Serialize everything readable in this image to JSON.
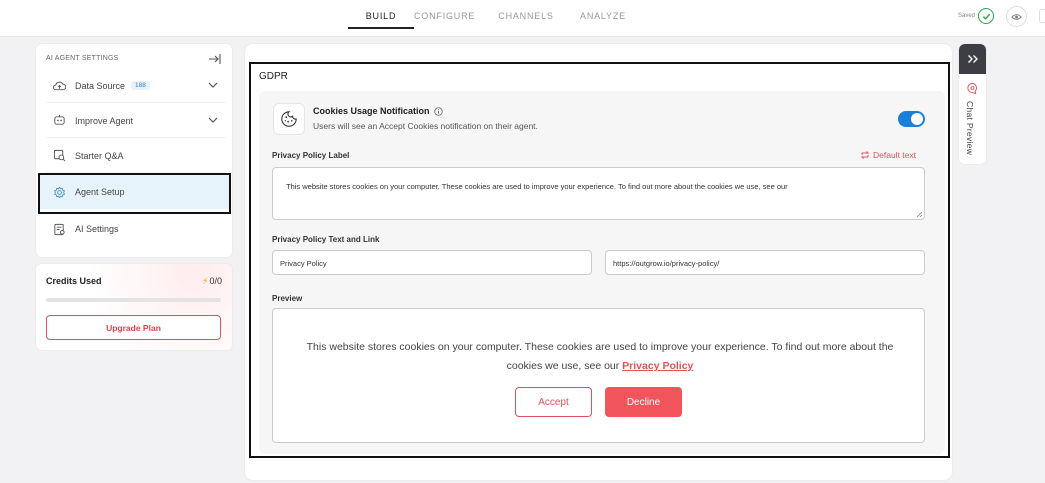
{
  "nav": {
    "tabs": [
      "BUILD",
      "CONFIGURE",
      "CHANNELS",
      "ANALYZE"
    ],
    "active_tab": "BUILD",
    "saved_label": "Saved"
  },
  "sidebar": {
    "header": "AI AGENT SETTINGS",
    "items": [
      {
        "label": "Data Source",
        "badge": "188",
        "icon": "data-source-icon"
      },
      {
        "label": "Improve Agent",
        "icon": "improve-agent-icon"
      },
      {
        "label": "Starter Q&A",
        "icon": "starter-qa-icon"
      },
      {
        "label": "Agent Setup",
        "icon": "gear-icon",
        "active": true
      },
      {
        "label": "AI Settings",
        "icon": "ai-settings-icon"
      }
    ]
  },
  "credits": {
    "title": "Credits Used",
    "value": "0/0",
    "progress": 0,
    "upgrade_label": "Upgrade Plan"
  },
  "gdpr": {
    "title": "GDPR",
    "cookie_title": "Cookies Usage Notification",
    "cookie_desc": "Users will see an Accept Cookies notification on their agent.",
    "toggle_on": true,
    "privacy_label_title": "Privacy Policy Label",
    "default_text": "Default text",
    "privacy_label_value": "This website stores cookies on your computer. These cookies are used to improve your experience. To find out more about the cookies we use, see our",
    "text_link_title": "Privacy Policy Text and Link",
    "policy_text": "Privacy Policy",
    "policy_link": "https://outgrow.io/privacy-policy/",
    "preview_title": "Preview",
    "preview_message": "This website stores cookies on your computer. These cookies are used to improve your experience. To find out more about the cookies we use, see our ",
    "preview_link": "Privacy Policy",
    "accept_label": "Accept",
    "decline_label": "Decline"
  },
  "chat_preview": {
    "label": "Chat Preview"
  },
  "colors": {
    "accent_red": "#e0525b",
    "toggle_blue": "#1a7fd9",
    "saved_green": "#2ea44f",
    "active_bg": "#e6f3fb"
  }
}
